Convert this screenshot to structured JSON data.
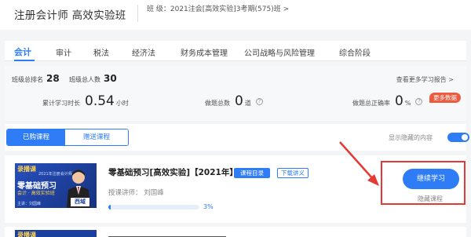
{
  "header": {
    "title": "注册会计师 高效实验班",
    "class_info": "班 级：2021注会[高效实验]3考期(575)班 >"
  },
  "tabs": [
    "会计",
    "审计",
    "税法",
    "经济法",
    "财务成本管理",
    "公司战略与风险管理",
    "综合阶段"
  ],
  "stats": {
    "rank_label": "班级总排名",
    "rank_value": "28",
    "people_label": "班级总人数",
    "people_value": "30",
    "more_report": "查看更多学习报告 >",
    "study_time_label": "累计学习时长",
    "study_time_value": "0.54",
    "study_time_unit": "小时",
    "total_questions_label": "做题总数",
    "total_questions_value": "0",
    "total_questions_unit": "道",
    "accuracy_label": "做题总正确率",
    "accuracy_value": "0",
    "accuracy_unit": "%",
    "more_data": "更多数据"
  },
  "filters": {
    "purchased": "已购课程",
    "gift": "赠送课程",
    "show_hidden": "显示隐藏的内容"
  },
  "course": {
    "thumb_tag": "录播课",
    "thumb_small": "2021年注册会计师",
    "thumb_title": "零基础预习",
    "thumb_subtitle": "会计 · 高效实验班",
    "thumb_teacher": "主讲：刘国峰",
    "thumb_name": "西域",
    "title": "零基础预习[高效实验]【2021年】",
    "catalog_badge": "课程目录",
    "download_badge": "下载讲义",
    "instructor": "授课讲师： 刘国峰",
    "progress": 3,
    "progress_text": "3%",
    "continue": "继续学习",
    "hide": "隐藏课程"
  },
  "course2": {
    "thumb_tag": "录播课"
  },
  "colors": {
    "accent": "#2e7cf6",
    "annotation": "#e53935",
    "badge_red": "#ee5a3e"
  }
}
